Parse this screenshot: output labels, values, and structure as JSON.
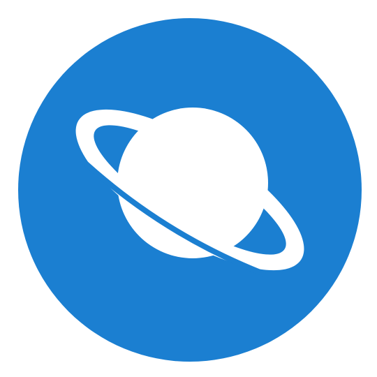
{
  "icon": {
    "name": "planet-icon",
    "colors": {
      "background": "#ffffff",
      "circle": "#1b7fd1",
      "glyph": "#ffffff"
    }
  }
}
